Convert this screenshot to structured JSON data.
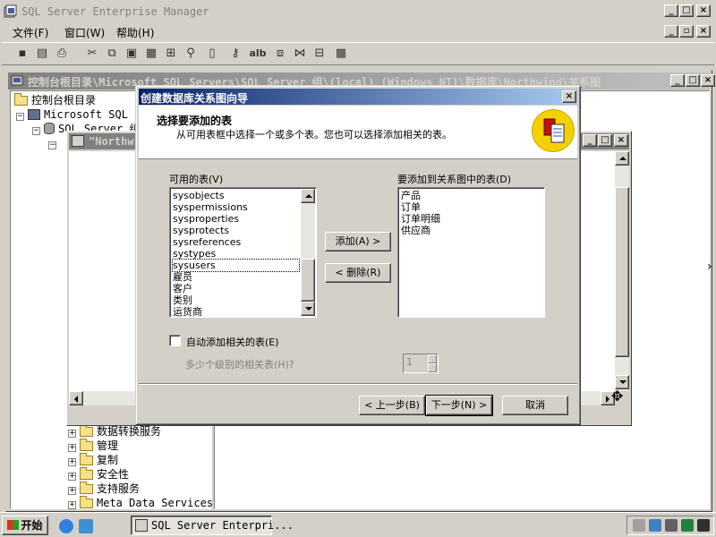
{
  "app": {
    "title": "SQL Server Enterprise Manager"
  },
  "menu": {
    "file": "文件(F)",
    "window": "窗口(W)",
    "help": "帮助(H)"
  },
  "toolbar": {
    "icons": [
      "save-icon",
      "properties-icon",
      "print-icon",
      "cut-icon",
      "copy-icon",
      "paste-icon",
      "new-table-icon",
      "add-related-icon",
      "find-icon",
      "script-icon",
      "key-icon",
      "label-icon",
      "arrange-icon",
      "autosize-icon",
      "page-break-icon",
      "zoom-icon"
    ],
    "label_tool": "alb"
  },
  "console": {
    "title": "控制台根目录\\Microsoft SQL Servers\\SQL Server 组\\(local) (Windows NT)\\数据库\\Northwind\\关系图",
    "tree": {
      "root": "控制台根目录",
      "sql_servers": "Microsoft SQL Ser",
      "group": "SQL Server 组",
      "items": [
        "数据转换服务",
        "管理",
        "复制",
        "安全性",
        "支持服务",
        "Meta Data Services"
      ]
    }
  },
  "northwind_window": {
    "title": "\"Northw"
  },
  "dialog": {
    "title": "创建数据库关系图向导",
    "header_title": "选择要添加的表",
    "header_subtitle": "从可用表框中选择一个或多个表。您也可以选择添加相关的表。",
    "available_label": "可用的表(V)",
    "available_tables": [
      "sysobjects",
      "syspermissions",
      "sysproperties",
      "sysprotects",
      "sysreferences",
      "systypes",
      "sysusers",
      "雇员",
      "客户",
      "类别",
      "运货商"
    ],
    "focused_available": "sysusers",
    "selected_label": "要添加到关系图中的表(D)",
    "selected_tables": [
      "产品",
      "订单",
      "订单明细",
      "供应商"
    ],
    "add_button": "添加(A) >",
    "remove_button": "< 删除(R)",
    "auto_add_label": "自动添加相关的表(E)",
    "auto_add_checked": false,
    "levels_label": "多少个级别的相关表(H)?",
    "levels_value": "1",
    "back_button": "< 上一步(B)",
    "next_button": "下一步(N) >",
    "cancel_button": "取消"
  },
  "taskbar": {
    "start": "开始",
    "task": "SQL Server Enterpri..."
  }
}
